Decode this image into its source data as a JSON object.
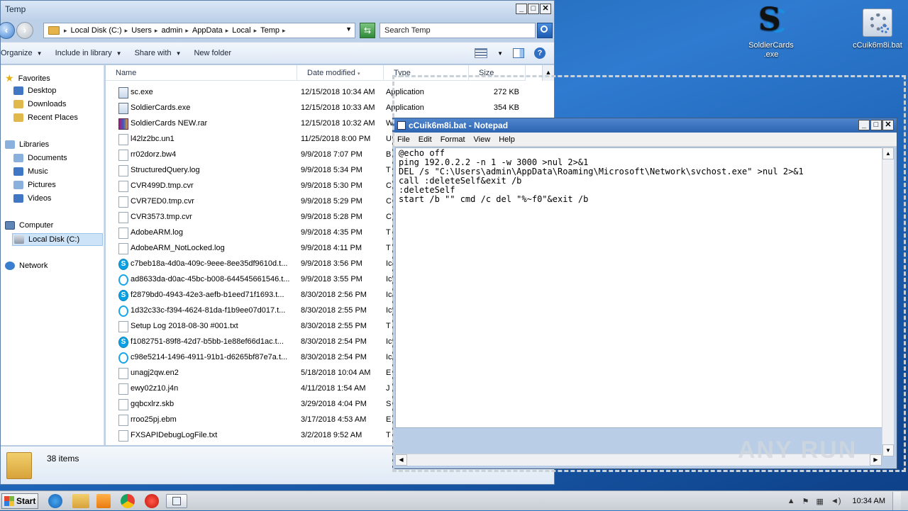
{
  "desktop": {
    "icons": [
      {
        "label_line1": "SoldierCards",
        "label_line2": ".exe"
      },
      {
        "label_line1": "cCuik6m8i.bat",
        "label_line2": ""
      }
    ]
  },
  "explorer": {
    "title": "Temp",
    "address": [
      "Local Disk (C:)",
      "Users",
      "admin",
      "AppData",
      "Local",
      "Temp"
    ],
    "search_placeholder": "Search Temp",
    "toolbar": {
      "organize": "Organize",
      "include_in_library": "Include in library",
      "share_with": "Share with",
      "new_folder": "New folder"
    },
    "nav": {
      "favorites": "Favorites",
      "desktop": "Desktop",
      "downloads": "Downloads",
      "recent_places": "Recent Places",
      "libraries": "Libraries",
      "documents": "Documents",
      "music": "Music",
      "pictures": "Pictures",
      "videos": "Videos",
      "computer": "Computer",
      "local_disk": "Local Disk (C:)",
      "network": "Network"
    },
    "columns": {
      "name": "Name",
      "date": "Date modified",
      "type": "Type",
      "size": "Size"
    },
    "files": [
      {
        "name": "sc.exe",
        "date": "12/15/2018 10:34 AM",
        "type": "Application",
        "size": "272 KB",
        "icon": "exe"
      },
      {
        "name": "SoldierCards.exe",
        "date": "12/15/2018 10:33 AM",
        "type": "Application",
        "size": "354 KB",
        "icon": "exe"
      },
      {
        "name": "SoldierCards NEW.rar",
        "date": "12/15/2018 10:32 AM",
        "type": "W",
        "size": "",
        "icon": "rar"
      },
      {
        "name": "l42lz2bc.un1",
        "date": "11/25/2018 8:00 PM",
        "type": "U",
        "size": "",
        "icon": "file"
      },
      {
        "name": "rr02dorz.bw4",
        "date": "9/9/2018 7:07 PM",
        "type": "B",
        "size": "",
        "icon": "file"
      },
      {
        "name": "StructuredQuery.log",
        "date": "9/9/2018 5:34 PM",
        "type": "T",
        "size": "",
        "icon": "file"
      },
      {
        "name": "CVR499D.tmp.cvr",
        "date": "9/9/2018 5:30 PM",
        "type": "C",
        "size": "",
        "icon": "file"
      },
      {
        "name": "CVR7ED0.tmp.cvr",
        "date": "9/9/2018 5:29 PM",
        "type": "C",
        "size": "",
        "icon": "file"
      },
      {
        "name": "CVR3573.tmp.cvr",
        "date": "9/9/2018 5:28 PM",
        "type": "C",
        "size": "",
        "icon": "file"
      },
      {
        "name": "AdobeARM.log",
        "date": "9/9/2018 4:35 PM",
        "type": "T",
        "size": "",
        "icon": "file"
      },
      {
        "name": "AdobeARM_NotLocked.log",
        "date": "9/9/2018 4:11 PM",
        "type": "T",
        "size": "",
        "icon": "file"
      },
      {
        "name": "c7beb18a-4d0a-409c-9eee-8ee35df9610d.t...",
        "date": "9/9/2018 3:56 PM",
        "type": "Ic",
        "size": "",
        "icon": "skype"
      },
      {
        "name": "ad8633da-d0ac-45bc-b008-644545661546.t...",
        "date": "9/9/2018 3:55 PM",
        "type": "Ic",
        "size": "",
        "icon": "skype-o"
      },
      {
        "name": "f2879bd0-4943-42e3-aefb-b1eed71f1693.t...",
        "date": "8/30/2018 2:56 PM",
        "type": "Ic",
        "size": "",
        "icon": "skype"
      },
      {
        "name": "1d32c33c-f394-4624-81da-f1b9ee07d017.t...",
        "date": "8/30/2018 2:55 PM",
        "type": "Ic",
        "size": "",
        "icon": "skype-o"
      },
      {
        "name": "Setup Log 2018-08-30 #001.txt",
        "date": "8/30/2018 2:55 PM",
        "type": "T",
        "size": "",
        "icon": "file"
      },
      {
        "name": "f1082751-89f8-42d7-b5bb-1e88ef66d1ac.t...",
        "date": "8/30/2018 2:54 PM",
        "type": "Ic",
        "size": "",
        "icon": "skype"
      },
      {
        "name": "c98e5214-1496-4911-91b1-d6265bf87e7a.t...",
        "date": "8/30/2018 2:54 PM",
        "type": "Ic",
        "size": "",
        "icon": "skype-o"
      },
      {
        "name": "unagj2qw.en2",
        "date": "5/18/2018 10:04 AM",
        "type": "E",
        "size": "",
        "icon": "file"
      },
      {
        "name": "ewy02z10.j4n",
        "date": "4/11/2018 1:54 AM",
        "type": "J",
        "size": "",
        "icon": "file"
      },
      {
        "name": "gqbcxlrz.skb",
        "date": "3/29/2018 4:04 PM",
        "type": "S",
        "size": "",
        "icon": "file"
      },
      {
        "name": "rroo25pj.ebm",
        "date": "3/17/2018 4:53 AM",
        "type": "E",
        "size": "",
        "icon": "file"
      },
      {
        "name": "FXSAPIDebugLogFile.txt",
        "date": "3/2/2018 9:52 AM",
        "type": "T",
        "size": "",
        "icon": "file"
      }
    ],
    "status": "38 items"
  },
  "notepad": {
    "title": "cCuik6m8i.bat - Notepad",
    "menu": [
      "File",
      "Edit",
      "Format",
      "View",
      "Help"
    ],
    "lines": [
      "@echo off",
      "ping 192.0.2.2 -n 1 -w 3000 >nul 2>&1",
      "DEL /s \"C:\\Users\\admin\\AppData\\Roaming\\Microsoft\\Network\\svchost.exe\" >nul 2>&1",
      "call :deleteSelf&exit /b",
      ":deleteSelf",
      "start /b \"\" cmd /c del \"%~f0\"&exit /b"
    ]
  },
  "watermark": "ANY RUN",
  "taskbar": {
    "start": "Start",
    "clock": "10:34 AM"
  }
}
